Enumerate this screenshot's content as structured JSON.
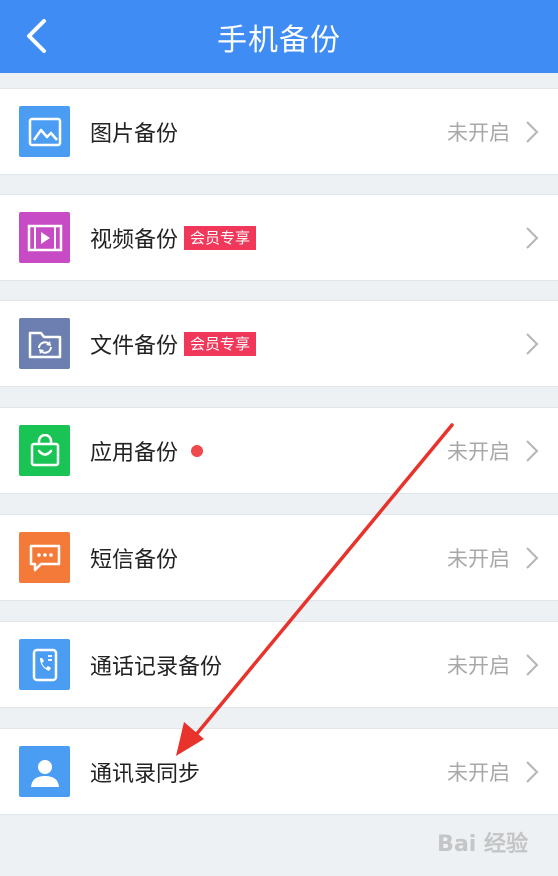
{
  "header": {
    "title": "手机备份",
    "back_icon": "chevron-left-icon"
  },
  "items": [
    {
      "label": "图片备份",
      "status": "未开启",
      "icon": "image-icon",
      "color": "#4a9df3"
    },
    {
      "label": "视频备份",
      "badge": "会员专享",
      "icon": "video-icon",
      "color": "#c64bc4"
    },
    {
      "label": "文件备份",
      "badge": "会员专享",
      "icon": "folder-sync-icon",
      "color": "#6d7fb0"
    },
    {
      "label": "应用备份",
      "status": "未开启",
      "icon": "shopping-bag-icon",
      "color": "#19c454",
      "dot": true
    },
    {
      "label": "短信备份",
      "status": "未开启",
      "icon": "message-icon",
      "color": "#f47a3a"
    },
    {
      "label": "通话记录备份",
      "status": "未开启",
      "icon": "call-log-icon",
      "color": "#4a9df3"
    },
    {
      "label": "通讯录同步",
      "status": "未开启",
      "icon": "contact-icon",
      "color": "#4a9df3"
    }
  ],
  "colors": {
    "header": "#3f8cf4",
    "badge": "#f2385a",
    "annotation_arrow": "#e8332c"
  },
  "watermark": "Bai 经验"
}
